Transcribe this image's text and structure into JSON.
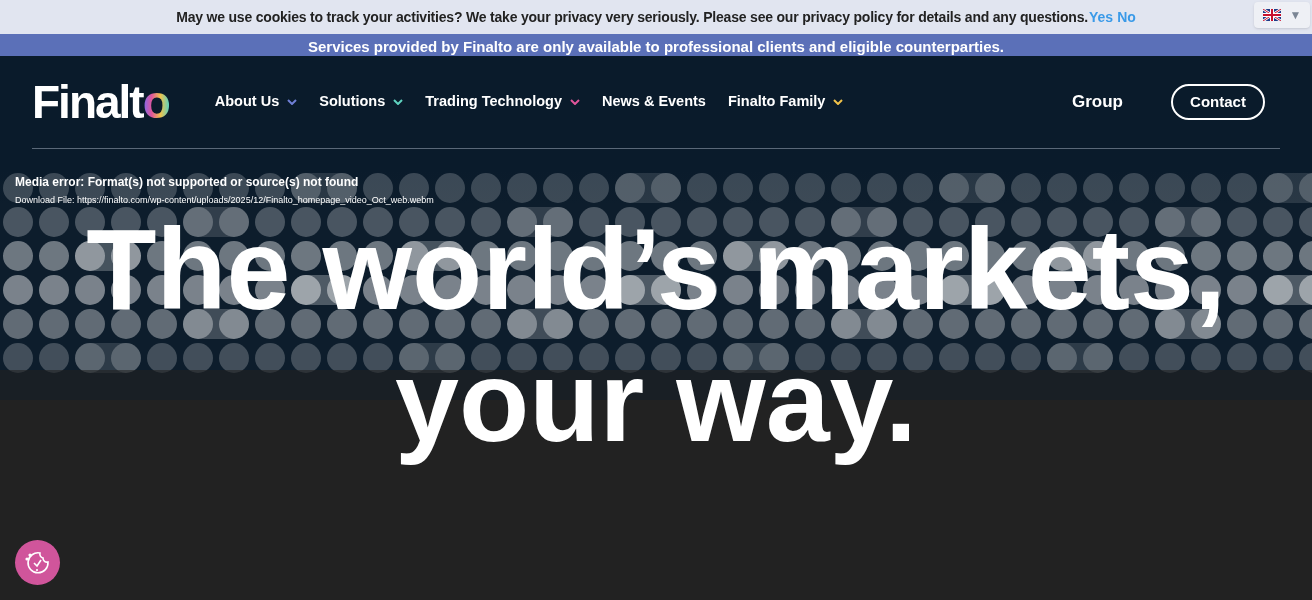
{
  "cookie_bar": {
    "message": "May we use cookies to track your activities? We take your privacy very seriously. Please see our privacy policy for details and any questions.",
    "yes": "Yes",
    "no": "No"
  },
  "language_selector": {
    "caret": "▼"
  },
  "notice_bar": {
    "text": "Services provided by Finalto are only available to professional clients and eligible counterparties."
  },
  "header": {
    "logo": "Finalto",
    "nav": [
      {
        "label": "About Us",
        "dropdown": true,
        "color": "#6f7fd6"
      },
      {
        "label": "Solutions",
        "dropdown": true,
        "color": "#5fd3c0"
      },
      {
        "label": "Trading Technology",
        "dropdown": true,
        "color": "#e0559a"
      },
      {
        "label": "News & Events",
        "dropdown": false
      },
      {
        "label": "Finalto Family",
        "dropdown": true,
        "color": "#f0c24a"
      }
    ],
    "group_link": "Group",
    "contact_button": "Contact"
  },
  "media_error": {
    "message": "Media error: Format(s) not supported or source(s) not found",
    "download": "Download File: https://finalto.com/wp-content/uploads/2025/12/Finalto_homepage_video_Oct_web.webm"
  },
  "hero": {
    "lines": [
      "The world’s markets,",
      "your way."
    ]
  }
}
